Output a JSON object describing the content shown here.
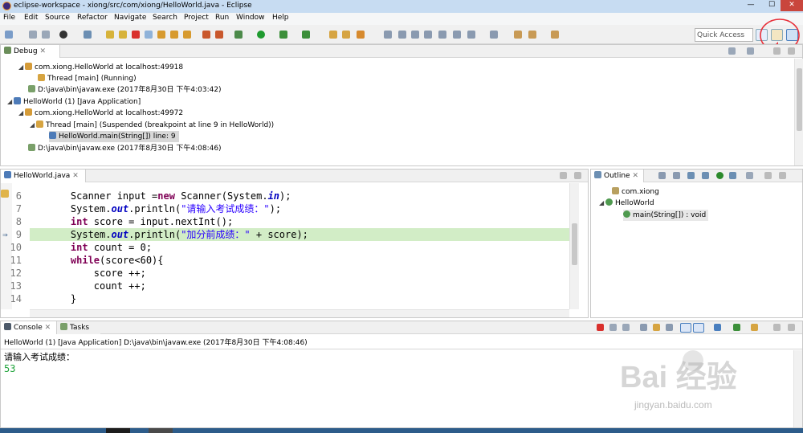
{
  "window": {
    "title": "eclipse-workspace - xiong/src/com/xiong/HelloWorld.java - Eclipse",
    "minimize": "—",
    "maximize": "☐",
    "close": "✕"
  },
  "menu": [
    "File",
    "Edit",
    "Source",
    "Refactor",
    "Navigate",
    "Search",
    "Project",
    "Run",
    "Window",
    "Help"
  ],
  "toolbar": {
    "quick_access": "Quick Access"
  },
  "debug": {
    "tab": "Debug",
    "rows": [
      {
        "text": "com.xiong.HelloWorld at localhost:49918",
        "icon": "java-app-icon"
      },
      {
        "text": "Thread [main] (Running)",
        "icon": "thread-running-icon"
      },
      {
        "text": "D:\\java\\bin\\javaw.exe (2017年8月30日 下午4:03:42)",
        "icon": "process-icon"
      },
      {
        "text": "HelloWorld (1) [Java Application]",
        "icon": "launch-icon"
      },
      {
        "text": "com.xiong.HelloWorld at localhost:49972",
        "icon": "java-app-icon"
      },
      {
        "text": "Thread [main] (Suspended (breakpoint at line 9 in HelloWorld))",
        "icon": "thread-suspended-icon"
      },
      {
        "text": "HelloWorld.main(String[]) line: 9",
        "icon": "stack-frame-icon"
      },
      {
        "text": "D:\\java\\bin\\javaw.exe (2017年8月30日 下午4:08:46)",
        "icon": "process-icon"
      }
    ]
  },
  "editor": {
    "tab": "HelloWorld.java",
    "current_line": 9,
    "lines": [
      {
        "n": "6",
        "code": "Scanner input =new Scanner(System.in);"
      },
      {
        "n": "7",
        "code": "System.out.println(\"请输入考试成绩：\");"
      },
      {
        "n": "8",
        "code": "int score = input.nextInt();"
      },
      {
        "n": "9",
        "code": "System.out.println(\"加分前成绩：\" + score);"
      },
      {
        "n": "10",
        "code": "int count = 0;"
      },
      {
        "n": "11",
        "code": "while(score<60){"
      },
      {
        "n": "12",
        "code": "    score ++;"
      },
      {
        "n": "13",
        "code": "    count ++;"
      },
      {
        "n": "14",
        "code": "}"
      }
    ]
  },
  "outline": {
    "tab": "Outline",
    "items": [
      {
        "text": "com.xiong",
        "icon": "package-icon"
      },
      {
        "text": "HelloWorld",
        "icon": "class-icon"
      },
      {
        "text": "main(String[]) : void",
        "icon": "method-icon"
      }
    ]
  },
  "console": {
    "tab": "Console",
    "tab2": "Tasks",
    "header": "HelloWorld (1) [Java Application] D:\\java\\bin\\javaw.exe (2017年8月30日 下午4:08:46)",
    "output": "请输入考试成绩：",
    "input": "53"
  },
  "watermark": {
    "brand": "Bai 经验",
    "url": "jingyan.baidu.com"
  },
  "colors": {
    "accent": "#e8303a",
    "titlebar": "#c7dcf2",
    "current_line": "#d2edc6",
    "string": "#2a00ff",
    "keyword": "#7f0055"
  }
}
